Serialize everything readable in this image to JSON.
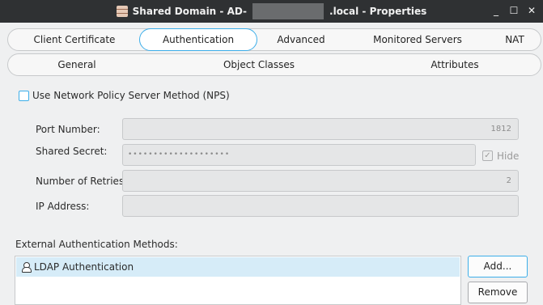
{
  "window": {
    "title_prefix": "Shared Domain - AD-",
    "title_suffix": ".local - Properties",
    "controls": [
      "_",
      "☐",
      "✕"
    ]
  },
  "tabs_row1": [
    "Client Certificate",
    "Authentication",
    "Advanced",
    "Monitored Servers",
    "NAT"
  ],
  "tabs_row2": [
    "General",
    "Object Classes",
    "Attributes"
  ],
  "active_tab": "Authentication",
  "nps": {
    "label": "Use Network Policy Server Method (NPS)",
    "checked": false
  },
  "fields": {
    "port": {
      "label": "Port Number:",
      "value": "1812"
    },
    "secret": {
      "label": "Shared Secret:",
      "value": "••••••••••••••••••••",
      "hide_label": "Hide",
      "hide_checked": true
    },
    "retries": {
      "label": "Number of Retries:",
      "value": "2"
    },
    "ip": {
      "label": "IP Address:",
      "value": ""
    }
  },
  "external": {
    "label": "External Authentication Methods:",
    "items": [
      {
        "label": "LDAP Authentication",
        "icon": "user-icon"
      }
    ],
    "add_label": "Add...",
    "remove_label": "Remove"
  }
}
